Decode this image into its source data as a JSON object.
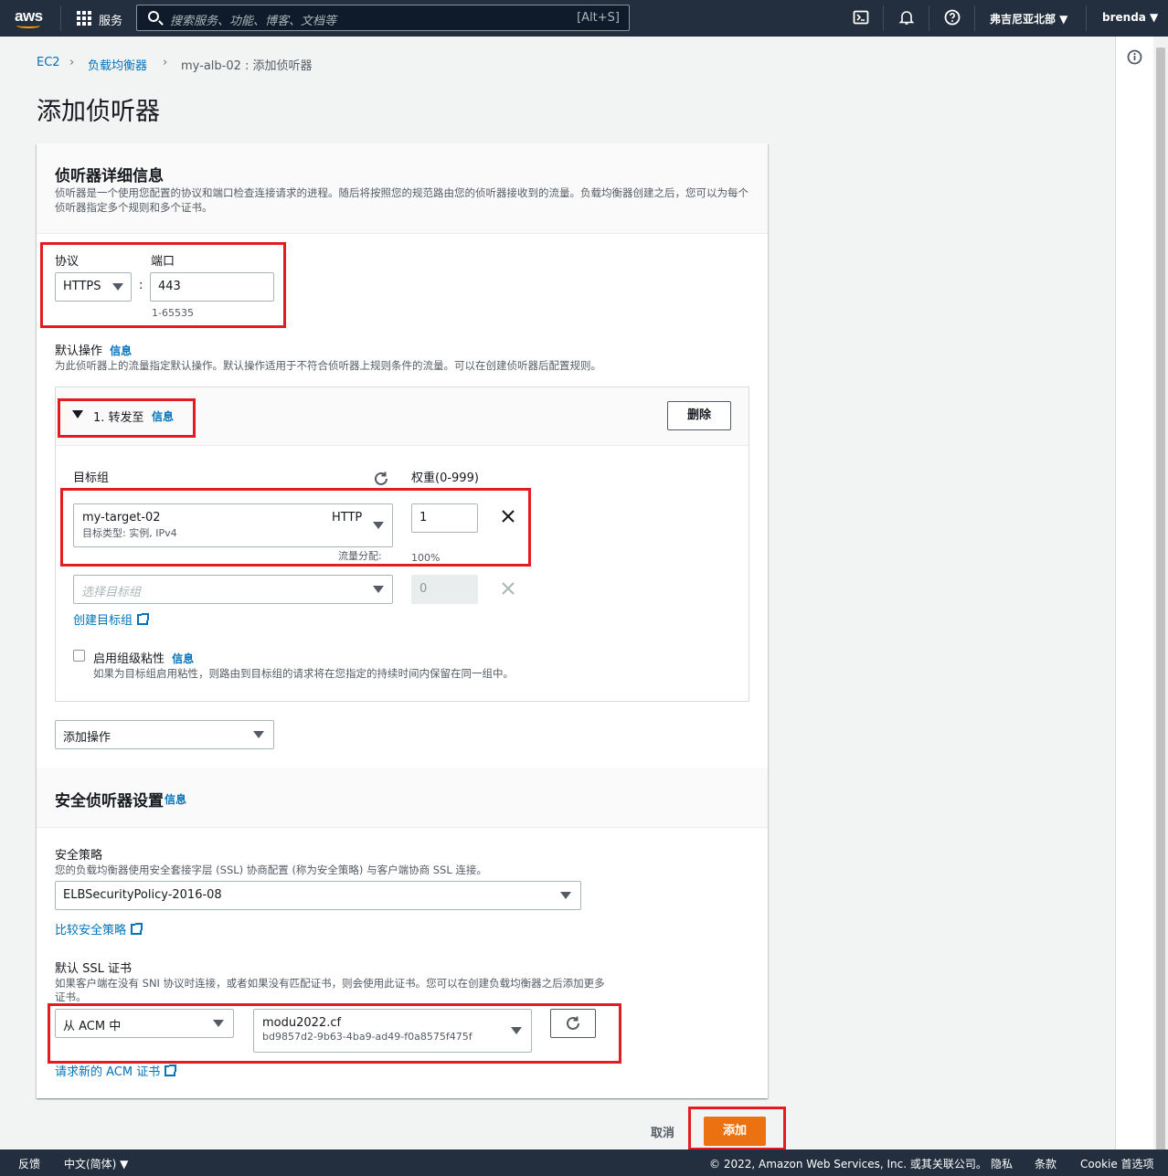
{
  "topnav": {
    "logo": "aws",
    "services": "服务",
    "search_placeholder": "搜索服务、功能、博客、文档等",
    "search_shortcut": "[Alt+S]",
    "region": "弗吉尼亚北部 ▼",
    "user": "brenda ▼",
    "icons": [
      "cloudshell-icon",
      "bell-icon",
      "help-icon"
    ]
  },
  "breadcrumb": {
    "items": [
      "EC2",
      "负载均衡器",
      "my-alb-02 : 添加侦听器"
    ]
  },
  "page_title": "添加侦听器",
  "listener": {
    "title": "侦听器详细信息",
    "description": "侦听器是一个使用您配置的协议和端口检查连接请求的进程。随后将按照您的规范路由您的侦听器接收到的流量。负载均衡器创建之后，您可以为每个侦听器指定多个规则和多个证书。",
    "protocol_label": "协议",
    "protocol_value": "HTTPS",
    "port_label": "端口",
    "port_value": "443",
    "port_hint": "1-65535",
    "colon": ":",
    "default_action_label": "默认操作",
    "info": "信息",
    "default_action_desc": "为此侦听器上的流量指定默认操作。默认操作适用于不符合侦听器上规则条件的流量。可以在创建侦听器后配置规则。",
    "action": {
      "title": "1. 转发至",
      "delete": "删除",
      "target_group_label": "目标组",
      "weight_label": "权重(0-999)",
      "tg_name": "my-target-02",
      "tg_protocol": "HTTP",
      "tg_type": "目标类型: 实例, IPv4",
      "tg_weight": "1",
      "traffic_label": "流量分配:",
      "traffic_value": "100%",
      "tg2_placeholder": "选择目标组",
      "tg2_weight": "0",
      "create_tg": "创建目标组",
      "stickiness_label": "启用组级粘性",
      "stickiness_desc": "如果为目标组启用粘性，则路由到目标组的请求将在您指定的持续时间内保留在同一组中。"
    },
    "add_action": "添加操作"
  },
  "security": {
    "title": "安全侦听器设置",
    "info": "信息",
    "policy_label": "安全策略",
    "policy_desc": "您的负载均衡器使用安全套接字层 (SSL) 协商配置 (称为安全策略) 与客户端协商 SSL 连接。",
    "policy_value": "ELBSecurityPolicy-2016-08",
    "compare_link": "比较安全策略",
    "cert_label": "默认 SSL 证书",
    "cert_desc_1": "如果客户端在没有 SNI 协议时连接，或者如果没有匹配证书，则会使用此证书。您可以在创建负载均衡器之后添加更多",
    "cert_desc_2": "证书。",
    "cert_source": "从 ACM 中",
    "cert_name": "modu2022.cf",
    "cert_id": "bd9857d2-9b63-4ba9-ad49-f0a8575f475f",
    "request_cert": "请求新的 ACM 证书"
  },
  "actions": {
    "cancel": "取消",
    "add": "添加"
  },
  "footer": {
    "feedback": "反馈",
    "language": "中文(简体) ▼",
    "copyright": "© 2022, Amazon Web Services, Inc. 或其关联公司。",
    "privacy": "隐私",
    "terms": "条款",
    "cookie": "Cookie 首选项"
  },
  "colors": {
    "nav_bg": "#232f3e",
    "link": "#0073bb",
    "primary": "#ec7211",
    "highlight": "#e31b23"
  }
}
